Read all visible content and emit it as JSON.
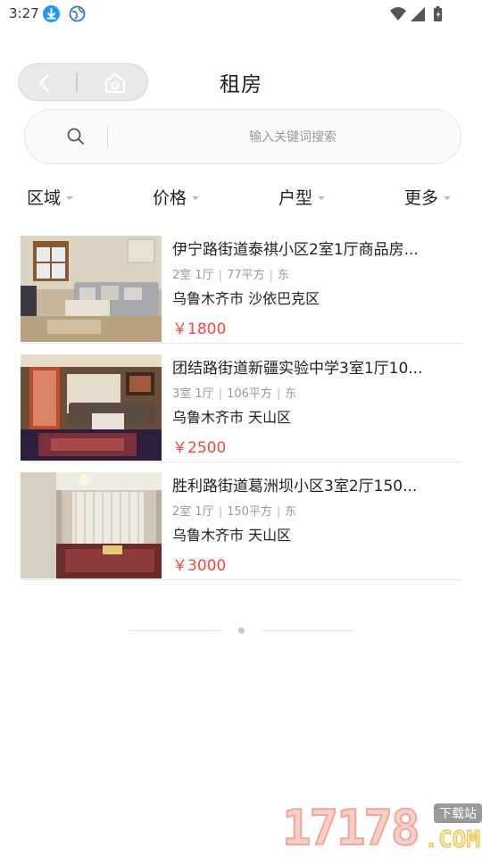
{
  "status_bar": {
    "time": "3:27",
    "left_icons": [
      "download-icon",
      "globe-icon"
    ],
    "right_icons": [
      "wifi-icon",
      "signal-icon",
      "battery-icon"
    ]
  },
  "header": {
    "title": "租房",
    "capsule_icons": [
      "back-icon",
      "home-icon"
    ]
  },
  "search": {
    "placeholder": "输入关键词搜索",
    "icon": "search-icon"
  },
  "filters": [
    {
      "label": "区域"
    },
    {
      "label": "价格"
    },
    {
      "label": "户型"
    },
    {
      "label": "更多"
    }
  ],
  "listings": [
    {
      "title": "伊宁路街道泰祺小区2室1厅商品房...",
      "rooms": "2室 1厅",
      "area": "77平方",
      "orientation": "东",
      "location": "乌鲁木齐市 沙依巴克区",
      "price": "￥1800"
    },
    {
      "title": "团结路街道新疆实验中学3室1厅10...",
      "rooms": "3室 1厅",
      "area": "106平方",
      "orientation": "东",
      "location": "乌鲁木齐市 天山区",
      "price": "￥2500"
    },
    {
      "title": "胜利路街道葛洲坝小区3室2厅150...",
      "rooms": "2室 1厅",
      "area": "150平方",
      "orientation": "东",
      "location": "乌鲁木齐市 天山区",
      "price": "￥3000"
    }
  ],
  "watermark": {
    "number": "17178",
    "badge": "下载站",
    "suffix": ".COM"
  },
  "colors": {
    "price": "#f04a3a",
    "meta": "#999999",
    "download_badge": "#1e9bf0"
  }
}
